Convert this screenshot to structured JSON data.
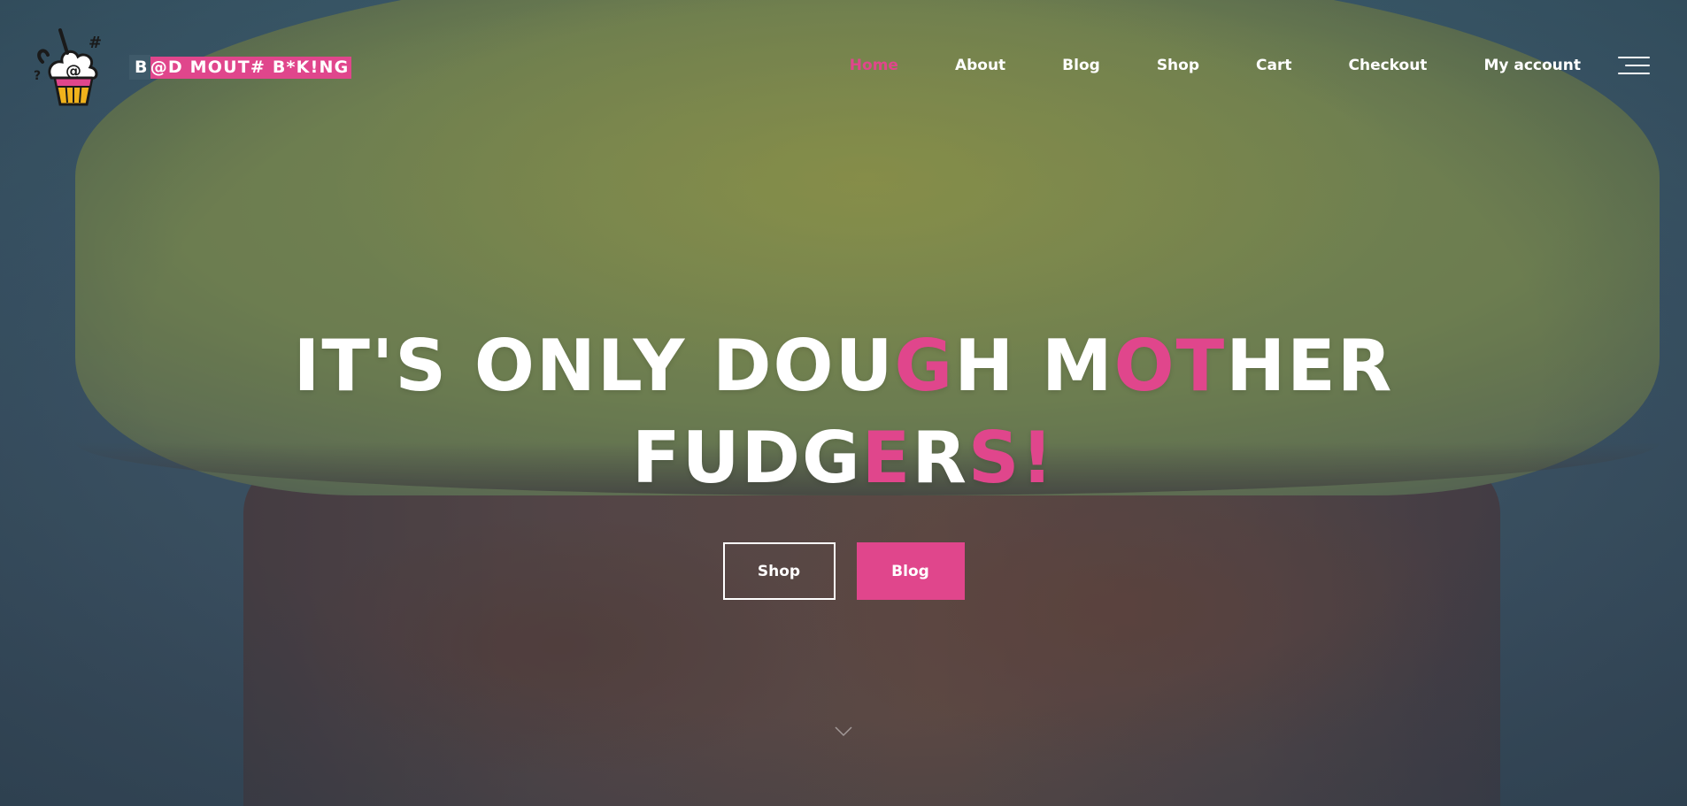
{
  "site": {
    "brand_part1": "B",
    "brand_part2": "@D MOUT# B*K!NG",
    "colors": {
      "accent": "#e0468c",
      "nav_text": "#ffffff",
      "overlay": "#3f5a6a"
    }
  },
  "nav": {
    "items": [
      {
        "label": "Home",
        "active": true
      },
      {
        "label": "About",
        "active": false
      },
      {
        "label": "Blog",
        "active": false
      },
      {
        "label": "Shop",
        "active": false
      },
      {
        "label": "Cart",
        "active": false
      },
      {
        "label": "Checkout",
        "active": false
      },
      {
        "label": "My account",
        "active": false
      }
    ],
    "menu_icon": "hamburger-menu-icon"
  },
  "hero": {
    "headline": {
      "line1": [
        {
          "text": "IT'S ONLY DOU",
          "accent": false
        },
        {
          "text": "G",
          "accent": true
        },
        {
          "text": "H M",
          "accent": false
        },
        {
          "text": "OT",
          "accent": true
        },
        {
          "text": "HER",
          "accent": false
        }
      ],
      "line2": [
        {
          "text": "FUDG",
          "accent": false
        },
        {
          "text": "E",
          "accent": true
        },
        {
          "text": "R",
          "accent": false
        },
        {
          "text": "S!",
          "accent": true
        }
      ]
    },
    "buttons": {
      "shop_label": "Shop",
      "blog_label": "Blog"
    },
    "scroll_icon": "chevron-down-icon"
  }
}
